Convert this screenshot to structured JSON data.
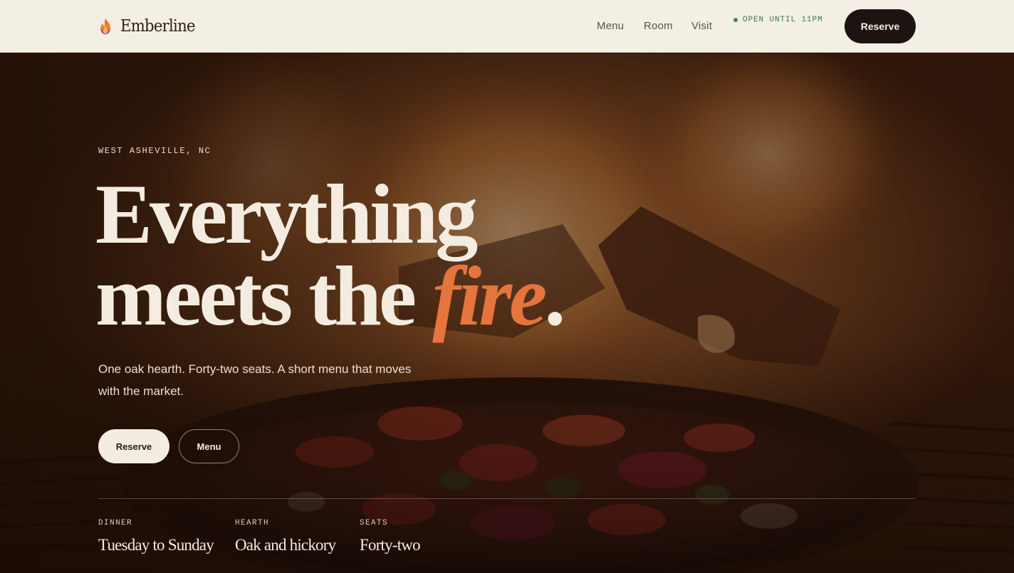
{
  "header": {
    "brand_name": "Emberline",
    "brand_icon": "flame-icon",
    "nav": [
      {
        "label": "Menu"
      },
      {
        "label": "Room"
      },
      {
        "label": "Visit"
      }
    ],
    "status_text": "OPEN UNTIL 11PM",
    "reserve_label": "Reserve"
  },
  "hero": {
    "eyebrow": "WEST ASHEVILLE, NC",
    "headline_line1": "Everything",
    "headline_line2_pre": "meets the ",
    "headline_accent": "fire",
    "headline_end": ".",
    "subtitle": "One oak hearth. Forty-two seats. A short menu that moves with the market.",
    "primary_cta": "Reserve",
    "secondary_cta": "Menu",
    "facts": [
      {
        "label": "DINNER",
        "value": "Tuesday to Sunday"
      },
      {
        "label": "HEARTH",
        "value": "Oak and hickory"
      },
      {
        "label": "SEATS",
        "value": "Forty-two"
      }
    ]
  },
  "colors": {
    "cream": "#f4efe4",
    "ink": "#1b1410",
    "accent": "#e5753c",
    "status_green": "#3d7a46"
  }
}
